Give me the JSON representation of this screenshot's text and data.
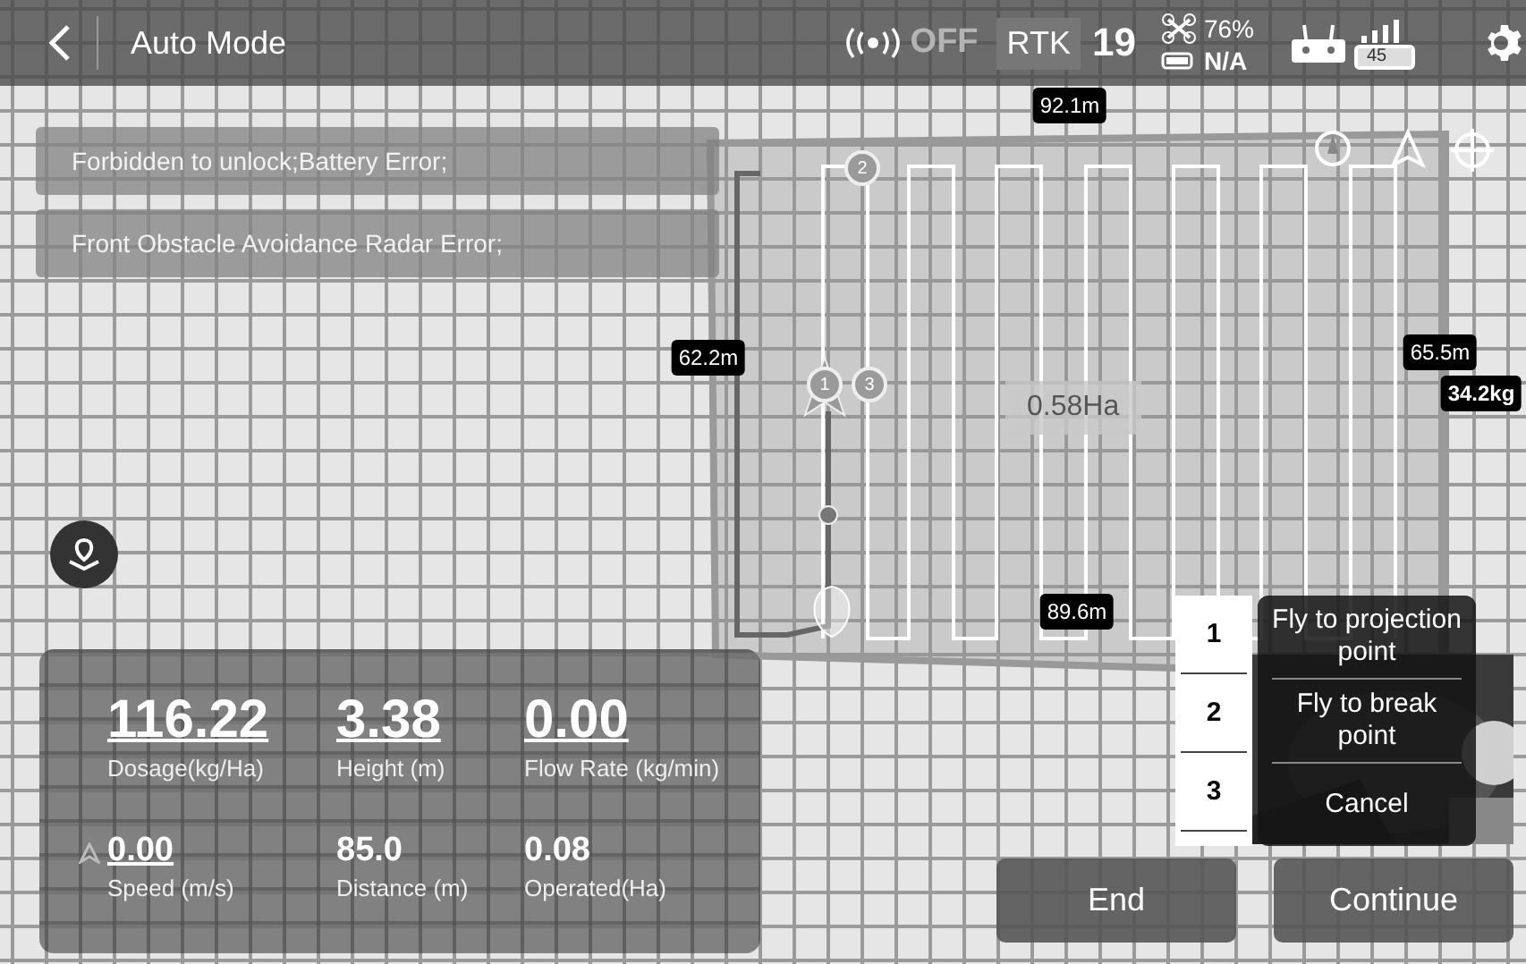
{
  "top_bar": {
    "title": "Auto Mode",
    "broadcast_status": "OFF",
    "rtk_label": "RTK",
    "satellites": "19",
    "drone_signal": "76%",
    "drone_battery": "N/A",
    "remote_battery": "45"
  },
  "alerts": [
    "Forbidden to unlock;Battery Error;",
    "Front Obstacle Avoidance Radar Error;"
  ],
  "map": {
    "area": "0.58Ha",
    "edge_labels": [
      "92.1m",
      "62.2m",
      "65.5m",
      "89.6m"
    ],
    "payload": "34.2kg",
    "waypoints": [
      "2",
      "1",
      "3"
    ]
  },
  "stats": [
    {
      "value": "116.22",
      "label": "Dosage(kg/Ha)",
      "underlined": true
    },
    {
      "value": "3.38",
      "label": "Height (m)",
      "underlined": true
    },
    {
      "value": "0.00",
      "label": "Flow Rate (kg/min)",
      "underlined": true
    },
    {
      "value": "0.00",
      "label": "Speed (m/s)",
      "underlined": true
    },
    {
      "value": "85.0",
      "label": "Distance (m)",
      "underlined": false
    },
    {
      "value": "0.08",
      "label": "Operated(Ha)",
      "underlined": false
    }
  ],
  "resume_menu": {
    "points": [
      "1",
      "2",
      "3"
    ],
    "options": [
      "Fly to projection point",
      "Fly to break point",
      "Cancel"
    ]
  },
  "actions": [
    "End",
    "Continue"
  ]
}
